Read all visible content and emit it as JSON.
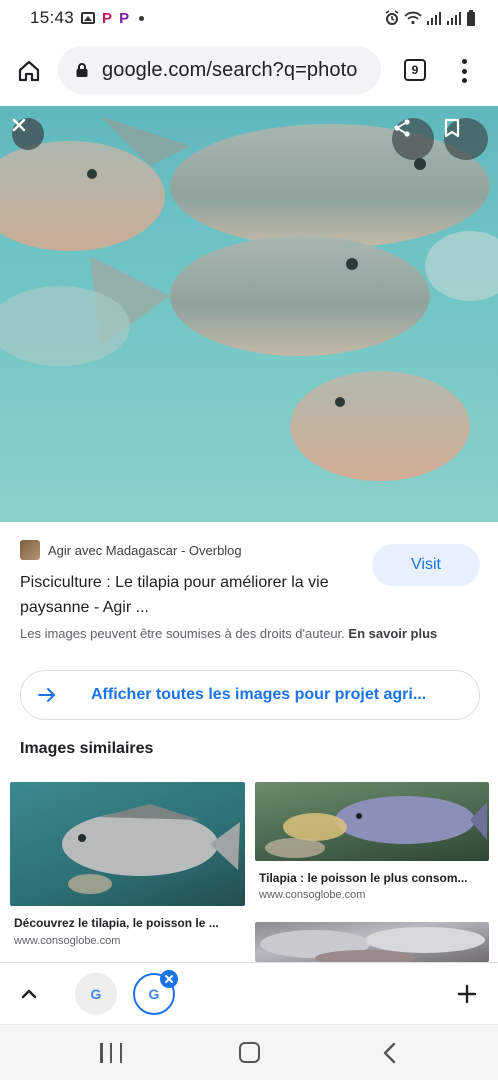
{
  "status_bar": {
    "time": "15:43",
    "notif_p1": "P",
    "notif_p2": "P",
    "right_icons": "⏰ ✈ ▮▮▮ ▮▮▮ ▮"
  },
  "browser": {
    "url": "google.com/search?q=photo",
    "tab_count": "9"
  },
  "result": {
    "source": "Agir avec Madagascar - Overblog",
    "visit_label": "Visit",
    "title": "Pisciculture : Le tilapia pour améliorer la vie paysanne - Agir ...",
    "copyright_text": "Les images peuvent être soumises à des droits d'auteur.",
    "copyright_link": "En savoir plus"
  },
  "all_images_label": "Afficher toutes les images pour projet agri...",
  "similar_heading": "Images similaires",
  "similar": [
    {
      "title": "Découvrez le tilapia, le poisson le ...",
      "domain": "www.consoglobe.com"
    },
    {
      "title": "Tilapia : le poisson le plus consom...",
      "domain": "www.consoglobe.com"
    }
  ],
  "tab_strip": {
    "tab1_letter": "G",
    "tab2_letter": "G"
  },
  "colors": {
    "accent": "#1a73e8",
    "visit_bg": "#e8f0fe"
  },
  "icons": [
    "home-icon",
    "lock-icon",
    "menu-dots-icon",
    "close-icon",
    "share-icon",
    "bookmark-icon",
    "arrow-right-icon",
    "chevron-up-icon",
    "plus-icon",
    "recents-icon",
    "nav-home-icon",
    "back-icon"
  ]
}
